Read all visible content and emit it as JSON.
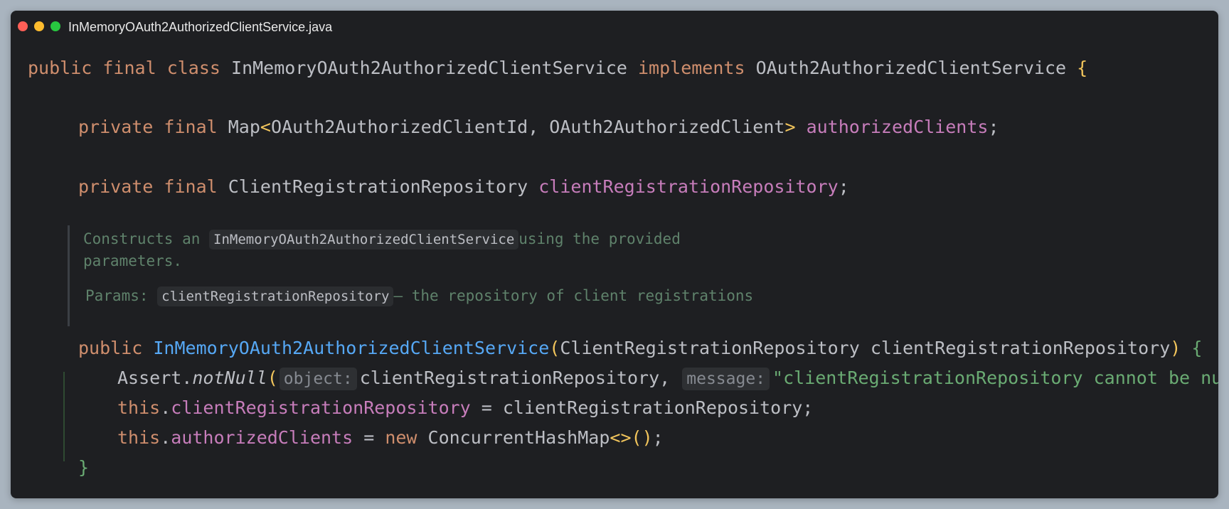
{
  "window": {
    "title": "InMemoryOAuth2AuthorizedClientService.java"
  },
  "code": {
    "l1": {
      "public": "public",
      "final": "final",
      "class": "class",
      "name": "InMemoryOAuth2AuthorizedClientService",
      "implements": "implements",
      "iface": "OAuth2AuthorizedClientService",
      "brace": "{"
    },
    "l2": {
      "private": "private",
      "final": "final",
      "type": "Map",
      "lt": "<",
      "generics": "OAuth2AuthorizedClientId, OAuth2AuthorizedClient",
      "gt": ">",
      "field": "authorizedClients",
      "semi": ";"
    },
    "l3": {
      "private": "private",
      "final": "final",
      "type": "ClientRegistrationRepository",
      "field": "clientRegistrationRepository",
      "semi": ";"
    },
    "doc": {
      "pre": "Constructs an ",
      "code": "InMemoryOAuth2AuthorizedClientService",
      "post": "using the provided",
      "line2": "parameters.",
      "params_label": "Params: ",
      "param_name": "clientRegistrationRepository",
      "param_desc": "– the repository of client registrations"
    },
    "l4": {
      "public": "public",
      "name": "InMemoryOAuth2AuthorizedClientService",
      "open": "(",
      "params": "ClientRegistrationRepository clientRegistrationRepository",
      "close": ")",
      "brace": "{"
    },
    "l5": {
      "assert": "Assert.",
      "method": "notNull",
      "open": "(",
      "hint1": "object:",
      "arg1": "clientRegistrationRepository, ",
      "hint2": "message:",
      "str": "\"clientRegistrationRepository cannot be null\"",
      "close": ")",
      "semi": ";"
    },
    "l6": {
      "this": "this",
      "dot": ".",
      "field": "clientRegistrationRepository",
      "rest": " = clientRegistrationRepository;"
    },
    "l7": {
      "this": "this",
      "dot": ".",
      "field": "authorizedClients",
      "eq": " = ",
      "new": "new",
      "type": " ConcurrentHashMap",
      "diamond": "<>",
      "parens": "()",
      "semi": ";"
    },
    "l8": {
      "brace": "}"
    }
  }
}
